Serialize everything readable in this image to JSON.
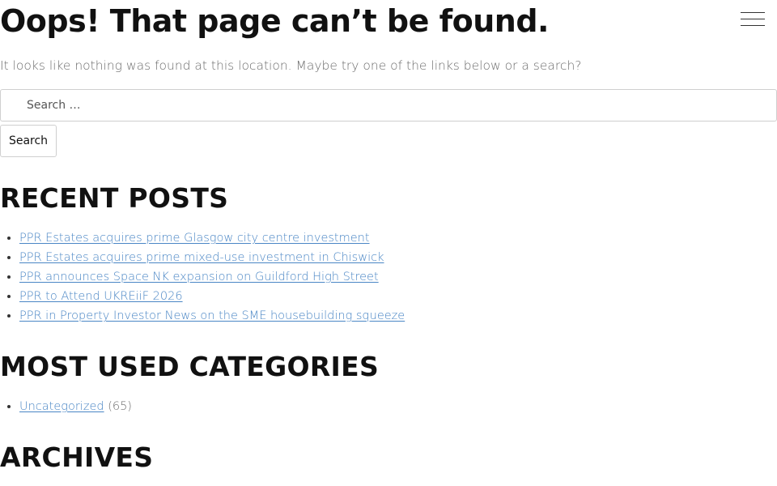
{
  "page": {
    "title": "Oops! That page can’t be found.",
    "intro": "It looks like nothing was found at this location. Maybe try one of the links below or a search?"
  },
  "header": {
    "menu_icon": "hamburger-menu-icon"
  },
  "search": {
    "placeholder": "Search …",
    "value": "",
    "button_label": "Search"
  },
  "recent_posts": {
    "heading": "RECENT POSTS",
    "items": [
      {
        "label": "PPR Estates acquires prime Glasgow city centre investment"
      },
      {
        "label": "PPR Estates acquires prime mixed-use investment in Chiswick"
      },
      {
        "label": "PPR announces Space NK expansion on Guildford High Street"
      },
      {
        "label": "PPR to Attend UKREiiF 2026"
      },
      {
        "label": "PPR in Property Investor News on the SME housebuilding squeeze"
      }
    ]
  },
  "categories": {
    "heading": "MOST USED CATEGORIES",
    "items": [
      {
        "label": "Uncategorized",
        "count": "(65)"
      }
    ]
  },
  "archives": {
    "heading": "ARCHIVES"
  },
  "colors": {
    "link": "#4a86c5",
    "text": "#111111",
    "muted": "#6d6d6d",
    "border": "#cfcfcf"
  }
}
